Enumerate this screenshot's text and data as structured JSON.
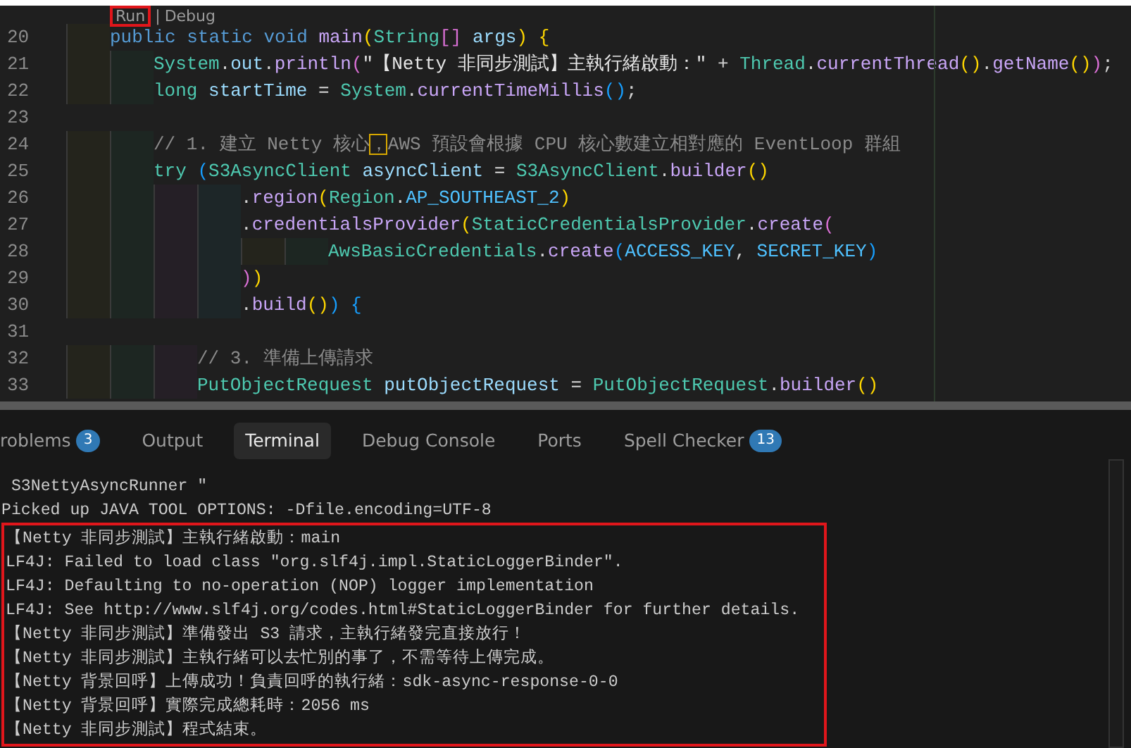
{
  "editor": {
    "codelens": {
      "separator": "|",
      "items": [
        {
          "label": "Run",
          "annotated": true
        },
        {
          "label": "Debug",
          "annotated": false
        }
      ]
    },
    "lines": [
      {
        "number": "20",
        "tokens": [
          {
            "kind": "kw",
            "text": "    public static void "
          },
          {
            "kind": "fn",
            "text": "main"
          },
          {
            "kind": "b1",
            "text": "("
          },
          {
            "kind": "type",
            "text": "String"
          },
          {
            "kind": "b2",
            "text": "[]"
          },
          {
            "kind": "var",
            "text": " args"
          },
          {
            "kind": "b1",
            "text": ")"
          },
          {
            "kind": "b1",
            "text": " {"
          }
        ]
      },
      {
        "number": "21",
        "tokens": [
          {
            "kind": "type",
            "text": "        System"
          },
          {
            "kind": "plain",
            "text": "."
          },
          {
            "kind": "var",
            "text": "out"
          },
          {
            "kind": "plain",
            "text": "."
          },
          {
            "kind": "fn",
            "text": "println"
          },
          {
            "kind": "b2",
            "text": "("
          },
          {
            "kind": "str",
            "text": "\"【Netty 非同步測試】主執行緒啟動：\""
          },
          {
            "kind": "plain",
            "text": " + "
          },
          {
            "kind": "type",
            "text": "Thread"
          },
          {
            "kind": "plain",
            "text": "."
          },
          {
            "kind": "fn",
            "text": "currentThread"
          },
          {
            "kind": "b1",
            "text": "()"
          },
          {
            "kind": "plain",
            "text": "."
          },
          {
            "kind": "fn",
            "text": "getName"
          },
          {
            "kind": "b1",
            "text": "()"
          },
          {
            "kind": "b2",
            "text": ")"
          },
          {
            "kind": "plain",
            "text": ";"
          }
        ]
      },
      {
        "number": "22",
        "tokens": [
          {
            "kind": "type",
            "text": "        long"
          },
          {
            "kind": "var",
            "text": " startTime"
          },
          {
            "kind": "plain",
            "text": " = "
          },
          {
            "kind": "type",
            "text": "System"
          },
          {
            "kind": "plain",
            "text": "."
          },
          {
            "kind": "fn",
            "text": "currentTimeMillis"
          },
          {
            "kind": "b3",
            "text": "()"
          },
          {
            "kind": "plain",
            "text": ";"
          }
        ]
      },
      {
        "number": "23"
      },
      {
        "number": "24",
        "tokens": [
          {
            "kind": "comment",
            "text": "        // 1. 建立 Netty 核心"
          },
          {
            "kind": "flagged",
            "text": "，"
          },
          {
            "kind": "comment",
            "text": "AWS 預設會根據 CPU 核心數建立相對應的 EventLoop 群組"
          }
        ]
      },
      {
        "number": "25",
        "tokens": [
          {
            "kind": "ctl",
            "text": "        try"
          },
          {
            "kind": "b3",
            "text": " ("
          },
          {
            "kind": "type",
            "text": "S3AsyncClient"
          },
          {
            "kind": "var",
            "text": " asyncClient"
          },
          {
            "kind": "plain",
            "text": " = "
          },
          {
            "kind": "type",
            "text": "S3AsyncClient"
          },
          {
            "kind": "plain",
            "text": "."
          },
          {
            "kind": "fn",
            "text": "builder"
          },
          {
            "kind": "b1",
            "text": "()"
          }
        ]
      },
      {
        "number": "26",
        "tokens": [
          {
            "kind": "plain",
            "text": "                ."
          },
          {
            "kind": "fn",
            "text": "region"
          },
          {
            "kind": "b1",
            "text": "("
          },
          {
            "kind": "type",
            "text": "Region"
          },
          {
            "kind": "plain",
            "text": "."
          },
          {
            "kind": "const",
            "text": "AP_SOUTHEAST_2"
          },
          {
            "kind": "b1",
            "text": ")"
          }
        ]
      },
      {
        "number": "27",
        "tokens": [
          {
            "kind": "plain",
            "text": "                ."
          },
          {
            "kind": "fn",
            "text": "credentialsProvider"
          },
          {
            "kind": "b1",
            "text": "("
          },
          {
            "kind": "type",
            "text": "StaticCredentialsProvider"
          },
          {
            "kind": "plain",
            "text": "."
          },
          {
            "kind": "fn",
            "text": "create"
          },
          {
            "kind": "b2",
            "text": "("
          }
        ]
      },
      {
        "number": "28",
        "tokens": [
          {
            "kind": "type",
            "text": "                        AwsBasicCredentials"
          },
          {
            "kind": "plain",
            "text": "."
          },
          {
            "kind": "fn",
            "text": "create"
          },
          {
            "kind": "b3",
            "text": "("
          },
          {
            "kind": "const",
            "text": "ACCESS_KEY"
          },
          {
            "kind": "plain",
            "text": ", "
          },
          {
            "kind": "const",
            "text": "SECRET_KEY"
          },
          {
            "kind": "b3",
            "text": ")"
          }
        ]
      },
      {
        "number": "29",
        "tokens": [
          {
            "kind": "b2",
            "text": "                )"
          },
          {
            "kind": "b1",
            "text": ")"
          }
        ]
      },
      {
        "number": "30",
        "tokens": [
          {
            "kind": "plain",
            "text": "                ."
          },
          {
            "kind": "fn",
            "text": "build"
          },
          {
            "kind": "b1",
            "text": "()"
          },
          {
            "kind": "b3",
            "text": ")"
          },
          {
            "kind": "b3",
            "text": " {"
          }
        ]
      },
      {
        "number": "31"
      },
      {
        "number": "32",
        "tokens": [
          {
            "kind": "comment",
            "text": "            // 3. 準備上傳請求"
          }
        ]
      },
      {
        "number": "33",
        "tokens": [
          {
            "kind": "type",
            "text": "            PutObjectRequest"
          },
          {
            "kind": "var",
            "text": " putObjectRequest"
          },
          {
            "kind": "plain",
            "text": " = "
          },
          {
            "kind": "type",
            "text": "PutObjectRequest"
          },
          {
            "kind": "plain",
            "text": "."
          },
          {
            "kind": "fn",
            "text": "builder"
          },
          {
            "kind": "b1",
            "text": "()"
          }
        ]
      }
    ]
  },
  "panel": {
    "tabs": [
      {
        "label": "roblems",
        "badge": "3",
        "selected": false
      },
      {
        "label": "Output",
        "selected": false
      },
      {
        "label": "Terminal",
        "selected": true
      },
      {
        "label": "Debug Console",
        "selected": false
      },
      {
        "label": "Ports",
        "selected": false
      },
      {
        "label": "Spell Checker",
        "badge": "13",
        "selected": false
      }
    ],
    "terminal": {
      "lines": [
        " S3NettyAsyncRunner \"",
        "Picked up JAVA TOOL OPTIONS: -Dfile.encoding=UTF-8"
      ],
      "highlighted_lines": [
        "【Netty 非同步測試】主執行緒啟動：main",
        "LF4J: Failed to load class \"org.slf4j.impl.StaticLoggerBinder\".",
        "LF4J: Defaulting to no-operation (NOP) logger implementation",
        "LF4J: See http://www.slf4j.org/codes.html#StaticLoggerBinder for further details.",
        "【Netty 非同步測試】準備發出 S3 請求，主執行緒發完直接放行！",
        "【Netty 非同步測試】主執行緒可以去忙別的事了，不需等待上傳完成。",
        "【Netty 背景回呼】上傳成功！負責回呼的執行緒：sdk-async-response-0-0",
        "【Netty 背景回呼】實際完成總耗時：2056 ms",
        "【Netty 非同步測試】程式結束。"
      ]
    }
  }
}
